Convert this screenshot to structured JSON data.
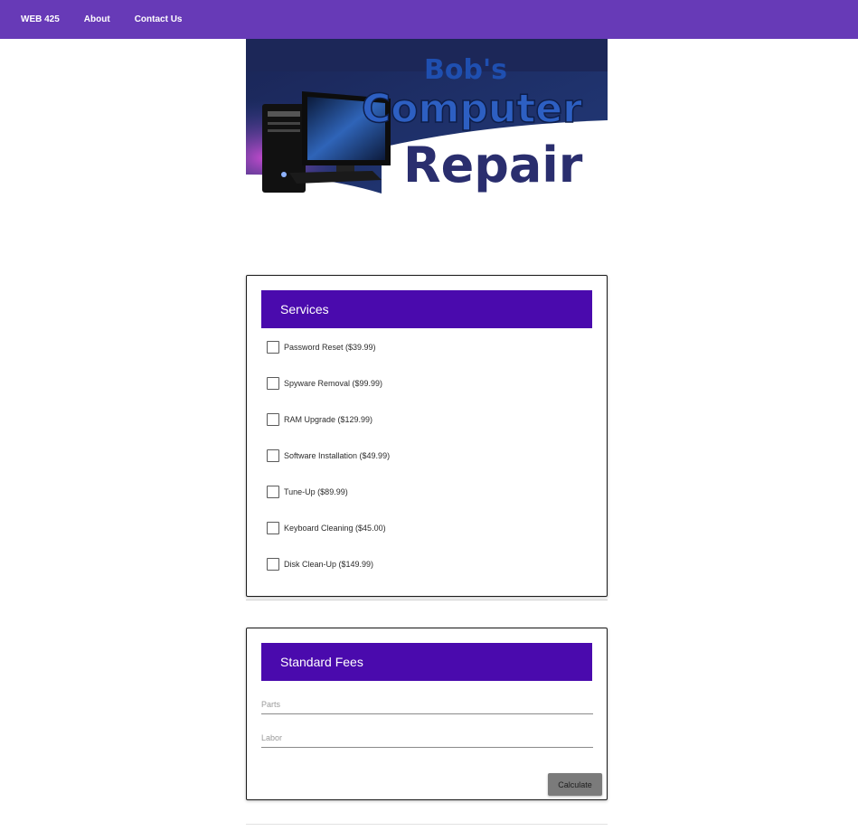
{
  "nav": {
    "items": [
      {
        "label": "WEB 425"
      },
      {
        "label": "About"
      },
      {
        "label": "Contact Us"
      }
    ]
  },
  "banner": {
    "line1": "Bob's",
    "line2": "Computer",
    "line3": "Repair",
    "colors": {
      "navy": "#1e2a5a",
      "blue": "#1f4fb0",
      "darkText": "#2a2e6e"
    }
  },
  "services": {
    "title": "Services",
    "items": [
      {
        "label": "Password Reset ($39.99)",
        "checked": false
      },
      {
        "label": "Spyware Removal ($99.99)",
        "checked": false
      },
      {
        "label": "RAM Upgrade ($129.99)",
        "checked": false
      },
      {
        "label": "Software Installation ($49.99)",
        "checked": false
      },
      {
        "label": "Tune-Up ($89.99)",
        "checked": false
      },
      {
        "label": "Keyboard Cleaning ($45.00)",
        "checked": false
      },
      {
        "label": "Disk Clean-Up ($149.99)",
        "checked": false
      }
    ]
  },
  "fees": {
    "title": "Standard Fees",
    "parts_placeholder": "Parts",
    "labor_placeholder": "Labor",
    "calculate_label": "Calculate"
  },
  "colors": {
    "navbar": "#673ab7",
    "cardHeader": "#4a0aad",
    "button": "#7b7b7b"
  }
}
